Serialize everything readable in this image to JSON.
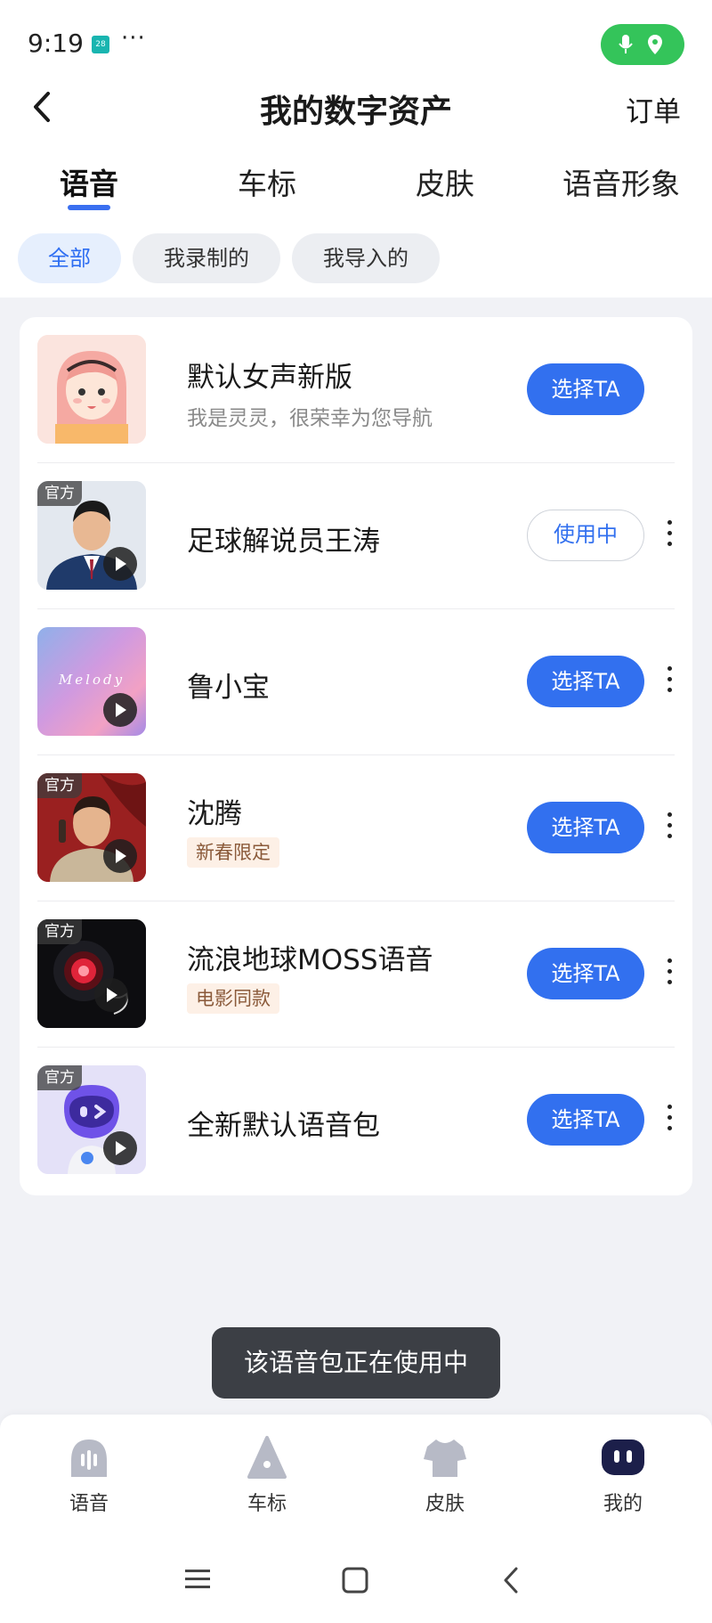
{
  "status_bar": {
    "time": "9:19",
    "notification_badge": "28",
    "more_dots": "···"
  },
  "header": {
    "title": "我的数字资产",
    "right_link": "订单"
  },
  "tabs": [
    {
      "label": "语音",
      "active": true
    },
    {
      "label": "车标",
      "active": false
    },
    {
      "label": "皮肤",
      "active": false
    },
    {
      "label": "语音形象",
      "active": false
    }
  ],
  "filters": [
    {
      "label": "全部",
      "active": true
    },
    {
      "label": "我录制的",
      "active": false
    },
    {
      "label": "我导入的",
      "active": false
    }
  ],
  "thumb_text": {
    "melody": "Melody"
  },
  "items": [
    {
      "name": "默认女声新版",
      "subtitle": "我是灵灵，很荣幸为您导航",
      "button": "选择TA",
      "official": false
    },
    {
      "name": "足球解说员王涛",
      "button": "使用中",
      "official": true,
      "badge": "官方",
      "in_use": true
    },
    {
      "name": "鲁小宝",
      "button": "选择TA",
      "official": false
    },
    {
      "name": "沈腾",
      "tag": "新春限定",
      "button": "选择TA",
      "official": true,
      "badge": "官方"
    },
    {
      "name": "流浪地球MOSS语音",
      "tag": "电影同款",
      "button": "选择TA",
      "official": true,
      "badge": "官方"
    },
    {
      "name": "全新默认语音包",
      "button": "选择TA",
      "official": true,
      "badge": "官方"
    }
  ],
  "toast": "该语音包正在使用中",
  "bottom_nav": [
    {
      "label": "语音",
      "icon": "voice-icon"
    },
    {
      "label": "车标",
      "icon": "car-logo-icon"
    },
    {
      "label": "皮肤",
      "icon": "skin-shirt-icon"
    },
    {
      "label": "我的",
      "icon": "profile-robot-icon",
      "active": true
    }
  ],
  "colors": {
    "accent": "#3270ef",
    "status_green": "#34c45a",
    "tag_bg": "#fdf0e6"
  }
}
